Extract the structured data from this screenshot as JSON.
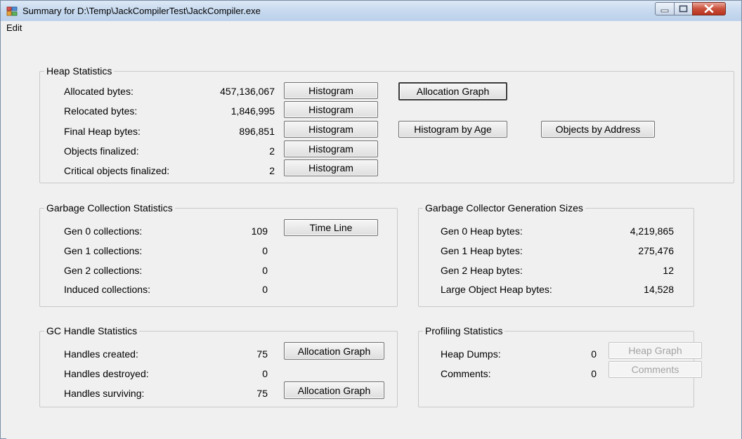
{
  "window": {
    "title": "Summary for D:\\Temp\\JackCompilerTest\\JackCompiler.exe"
  },
  "menu": {
    "edit": "Edit"
  },
  "heap": {
    "legend": "Heap Statistics",
    "rows": [
      {
        "label": "Allocated bytes:",
        "value": "457,136,067",
        "button": "Histogram"
      },
      {
        "label": "Relocated bytes:",
        "value": "1,846,995",
        "button": "Histogram"
      },
      {
        "label": "Final Heap bytes:",
        "value": "896,851",
        "button": "Histogram"
      },
      {
        "label": "Objects finalized:",
        "value": "2",
        "button": "Histogram"
      },
      {
        "label": "Critical objects finalized:",
        "value": "2",
        "button": "Histogram"
      }
    ],
    "allocation_graph": "Allocation Graph",
    "histogram_by_age": "Histogram by Age",
    "objects_by_address": "Objects by Address"
  },
  "gc": {
    "legend": "Garbage Collection Statistics",
    "rows": [
      {
        "label": "Gen 0 collections:",
        "value": "109"
      },
      {
        "label": "Gen 1 collections:",
        "value": "0"
      },
      {
        "label": "Gen 2 collections:",
        "value": "0"
      },
      {
        "label": "Induced collections:",
        "value": "0"
      }
    ],
    "timeline": "Time Line"
  },
  "gen_sizes": {
    "legend": "Garbage Collector Generation Sizes",
    "rows": [
      {
        "label": "Gen 0 Heap bytes:",
        "value": "4,219,865"
      },
      {
        "label": "Gen 1 Heap bytes:",
        "value": "275,476"
      },
      {
        "label": "Gen 2 Heap bytes:",
        "value": "12"
      },
      {
        "label": "Large Object Heap bytes:",
        "value": "14,528"
      }
    ]
  },
  "handles": {
    "legend": "GC Handle Statistics",
    "rows": [
      {
        "label": "Handles created:",
        "value": "75"
      },
      {
        "label": "Handles destroyed:",
        "value": "0"
      },
      {
        "label": "Handles surviving:",
        "value": "75"
      }
    ],
    "allocation_graph_created": "Allocation Graph",
    "allocation_graph_surviving": "Allocation Graph"
  },
  "profiling": {
    "legend": "Profiling Statistics",
    "rows": [
      {
        "label": "Heap Dumps:",
        "value": "0",
        "button": "Heap Graph"
      },
      {
        "label": "Comments:",
        "value": "0",
        "button": "Comments"
      }
    ]
  }
}
